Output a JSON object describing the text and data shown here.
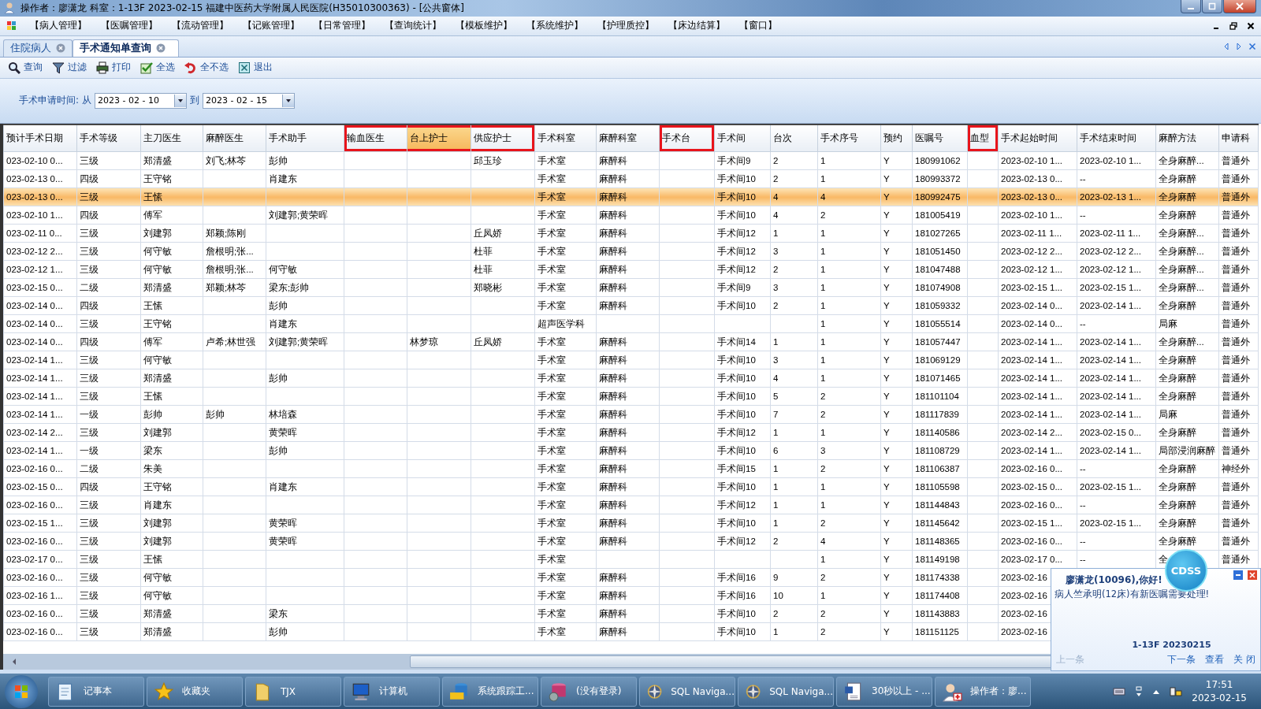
{
  "window": {
    "title": "操作者：廖潇龙  科室：1-13F  2023-02-15  福建中医药大学附属人民医院(H35010300363) - [公共窗体]"
  },
  "menu": [
    "【病人管理】",
    "【医嘱管理】",
    "【流动管理】",
    "【记账管理】",
    "【日常管理】",
    "【查询统计】",
    "【模板维护】",
    "【系统维护】",
    "【护理质控】",
    "【床边结算】",
    "【窗口】"
  ],
  "tabs": [
    {
      "label": "住院病人",
      "selected": false
    },
    {
      "label": "手术通知单查询",
      "selected": true
    }
  ],
  "toolbar": [
    {
      "label": "查询",
      "kind": "search"
    },
    {
      "label": "过滤",
      "kind": "filter"
    },
    {
      "label": "打印",
      "kind": "print"
    },
    {
      "label": "全选",
      "kind": "check"
    },
    {
      "label": "全不选",
      "kind": "undo"
    },
    {
      "label": "退出",
      "kind": "exit"
    }
  ],
  "filter": {
    "label": "手术申请时间:",
    "from_label": "从",
    "from": "2023 - 02 - 10",
    "to_label": "到",
    "to": "2023 - 02 - 15"
  },
  "table": {
    "columns": [
      {
        "label": "预计手术日期",
        "selected": false,
        "marked": false
      },
      {
        "label": "手术等级",
        "selected": false,
        "marked": false
      },
      {
        "label": "主刀医生",
        "selected": false,
        "marked": false
      },
      {
        "label": "麻醉医生",
        "selected": false,
        "marked": false
      },
      {
        "label": "手术助手",
        "selected": false,
        "marked": false
      },
      {
        "label": "输血医生",
        "selected": false,
        "marked": true
      },
      {
        "label": "台上护士",
        "selected": true,
        "marked": true
      },
      {
        "label": "供应护士",
        "selected": false,
        "marked": true
      },
      {
        "label": "手术科室",
        "selected": false,
        "marked": false
      },
      {
        "label": "麻醉科室",
        "selected": false,
        "marked": false
      },
      {
        "label": "手术台",
        "selected": false,
        "marked": true
      },
      {
        "label": "手术间",
        "selected": false,
        "marked": false
      },
      {
        "label": "台次",
        "selected": false,
        "marked": false
      },
      {
        "label": "手术序号",
        "selected": false,
        "marked": false
      },
      {
        "label": "预约",
        "selected": false,
        "marked": false
      },
      {
        "label": "医嘱号",
        "selected": false,
        "marked": false
      },
      {
        "label": "血型",
        "selected": false,
        "marked": true
      },
      {
        "label": "手术起始时间",
        "selected": false,
        "marked": false
      },
      {
        "label": "手术结束时间",
        "selected": false,
        "marked": false
      },
      {
        "label": "麻醉方法",
        "selected": false,
        "marked": false
      },
      {
        "label": "申请科",
        "selected": false,
        "marked": false
      }
    ],
    "rows": [
      {
        "selected": false,
        "cells": [
          "023-02-10 0...",
          "三级",
          "郑清盛",
          "刘飞;林芩",
          "彭帅",
          null,
          null,
          "邱玉珍",
          "手术室",
          "麻醉科",
          null,
          "手术间9",
          "2",
          "1",
          "Y",
          "180991062",
          null,
          "2023-02-10 1...",
          "2023-02-10 1...",
          "全身麻醉...",
          "普通外"
        ]
      },
      {
        "selected": false,
        "cells": [
          "023-02-13 0...",
          "四级",
          "王守铭",
          null,
          "肖建东",
          null,
          null,
          null,
          "手术室",
          "麻醉科",
          null,
          "手术间10",
          "2",
          "1",
          "Y",
          "180993372",
          null,
          "2023-02-13 0...",
          "--",
          "全身麻醉",
          "普通外"
        ]
      },
      {
        "selected": true,
        "cells": [
          "023-02-13 0...",
          "三级",
          "王愫",
          null,
          null,
          null,
          null,
          null,
          "手术室",
          "麻醉科",
          null,
          "手术间10",
          "4",
          "4",
          "Y",
          "180992475",
          null,
          "2023-02-13 0...",
          "2023-02-13 1...",
          "全身麻醉",
          "普通外"
        ]
      },
      {
        "selected": false,
        "cells": [
          "023-02-10 1...",
          "四级",
          "傅军",
          null,
          "刘建郭;黄荣晖",
          null,
          null,
          null,
          "手术室",
          "麻醉科",
          null,
          "手术间10",
          "4",
          "2",
          "Y",
          "181005419",
          null,
          "2023-02-10 1...",
          "--",
          "全身麻醉",
          "普通外"
        ]
      },
      {
        "selected": false,
        "cells": [
          "023-02-11 0...",
          "三级",
          "刘建郭",
          "郑颖;陈刚",
          null,
          null,
          null,
          "丘凤娇",
          "手术室",
          "麻醉科",
          null,
          "手术间12",
          "1",
          "1",
          "Y",
          "181027265",
          null,
          "2023-02-11 1...",
          "2023-02-11 1...",
          "全身麻醉...",
          "普通外"
        ]
      },
      {
        "selected": false,
        "cells": [
          "023-02-12 2...",
          "三级",
          "何守敏",
          "詹根明;张...",
          null,
          null,
          null,
          "杜菲",
          "手术室",
          "麻醉科",
          null,
          "手术间12",
          "3",
          "1",
          "Y",
          "181051450",
          null,
          "2023-02-12 2...",
          "2023-02-12 2...",
          "全身麻醉...",
          "普通外"
        ]
      },
      {
        "selected": false,
        "cells": [
          "023-02-12 1...",
          "三级",
          "何守敏",
          "詹根明;张...",
          "何守敏",
          null,
          null,
          "杜菲",
          "手术室",
          "麻醉科",
          null,
          "手术间12",
          "2",
          "1",
          "Y",
          "181047488",
          null,
          "2023-02-12 1...",
          "2023-02-12 1...",
          "全身麻醉...",
          "普通外"
        ]
      },
      {
        "selected": false,
        "cells": [
          "023-02-15 0...",
          "二级",
          "郑清盛",
          "郑颖;林芩",
          "梁东;彭帅",
          null,
          null,
          "郑晓彬",
          "手术室",
          "麻醉科",
          null,
          "手术间9",
          "3",
          "1",
          "Y",
          "181074908",
          null,
          "2023-02-15 1...",
          "2023-02-15 1...",
          "全身麻醉...",
          "普通外"
        ]
      },
      {
        "selected": false,
        "cells": [
          "023-02-14 0...",
          "四级",
          "王愫",
          null,
          "彭帅",
          null,
          null,
          null,
          "手术室",
          "麻醉科",
          null,
          "手术间10",
          "2",
          "1",
          "Y",
          "181059332",
          null,
          "2023-02-14 0...",
          "2023-02-14 1...",
          "全身麻醉",
          "普通外"
        ]
      },
      {
        "selected": false,
        "cells": [
          "023-02-14 0...",
          "三级",
          "王守铭",
          null,
          "肖建东",
          null,
          null,
          null,
          "超声医学科",
          null,
          null,
          null,
          null,
          "1",
          "Y",
          "181055514",
          null,
          "2023-02-14 0...",
          "--",
          "局麻",
          "普通外"
        ]
      },
      {
        "selected": false,
        "cells": [
          "023-02-14 0...",
          "四级",
          "傅军",
          "卢希;林世强",
          "刘建郭;黄荣晖",
          null,
          "林梦琼",
          "丘凤娇",
          "手术室",
          "麻醉科",
          null,
          "手术间14",
          "1",
          "1",
          "Y",
          "181057447",
          null,
          "2023-02-14 1...",
          "2023-02-14 1...",
          "全身麻醉...",
          "普通外"
        ]
      },
      {
        "selected": false,
        "cells": [
          "023-02-14 1...",
          "三级",
          "何守敏",
          null,
          null,
          null,
          null,
          null,
          "手术室",
          "麻醉科",
          null,
          "手术间10",
          "3",
          "1",
          "Y",
          "181069129",
          null,
          "2023-02-14 1...",
          "2023-02-14 1...",
          "全身麻醉",
          "普通外"
        ]
      },
      {
        "selected": false,
        "cells": [
          "023-02-14 1...",
          "三级",
          "郑清盛",
          null,
          "彭帅",
          null,
          null,
          null,
          "手术室",
          "麻醉科",
          null,
          "手术间10",
          "4",
          "1",
          "Y",
          "181071465",
          null,
          "2023-02-14 1...",
          "2023-02-14 1...",
          "全身麻醉",
          "普通外"
        ]
      },
      {
        "selected": false,
        "cells": [
          "023-02-14 1...",
          "三级",
          "王愫",
          null,
          null,
          null,
          null,
          null,
          "手术室",
          "麻醉科",
          null,
          "手术间10",
          "5",
          "2",
          "Y",
          "181101104",
          null,
          "2023-02-14 1...",
          "2023-02-14 1...",
          "全身麻醉",
          "普通外"
        ]
      },
      {
        "selected": false,
        "cells": [
          "023-02-14 1...",
          "一级",
          "彭帅",
          "彭帅",
          "林培森",
          null,
          null,
          null,
          "手术室",
          "麻醉科",
          null,
          "手术间10",
          "7",
          "2",
          "Y",
          "181117839",
          null,
          "2023-02-14 1...",
          "2023-02-14 1...",
          "局麻",
          "普通外"
        ]
      },
      {
        "selected": false,
        "cells": [
          "023-02-14 2...",
          "三级",
          "刘建郭",
          null,
          "黄荣晖",
          null,
          null,
          null,
          "手术室",
          "麻醉科",
          null,
          "手术间12",
          "1",
          "1",
          "Y",
          "181140586",
          null,
          "2023-02-14 2...",
          "2023-02-15 0...",
          "全身麻醉",
          "普通外"
        ]
      },
      {
        "selected": false,
        "cells": [
          "023-02-14 1...",
          "一级",
          "梁东",
          null,
          "彭帅",
          null,
          null,
          null,
          "手术室",
          "麻醉科",
          null,
          "手术间10",
          "6",
          "3",
          "Y",
          "181108729",
          null,
          "2023-02-14 1...",
          "2023-02-14 1...",
          "局部浸润麻醉",
          "普通外"
        ]
      },
      {
        "selected": false,
        "cells": [
          "023-02-16 0...",
          "二级",
          "朱美",
          null,
          null,
          null,
          null,
          null,
          "手术室",
          "麻醉科",
          null,
          "手术间15",
          "1",
          "2",
          "Y",
          "181106387",
          null,
          "2023-02-16 0...",
          "--",
          "全身麻醉",
          "神经外"
        ]
      },
      {
        "selected": false,
        "cells": [
          "023-02-15 0...",
          "四级",
          "王守铭",
          null,
          "肖建东",
          null,
          null,
          null,
          "手术室",
          "麻醉科",
          null,
          "手术间10",
          "1",
          "1",
          "Y",
          "181105598",
          null,
          "2023-02-15 0...",
          "2023-02-15 1...",
          "全身麻醉",
          "普通外"
        ]
      },
      {
        "selected": false,
        "cells": [
          "023-02-16 0...",
          "三级",
          "肖建东",
          null,
          null,
          null,
          null,
          null,
          "手术室",
          "麻醉科",
          null,
          "手术间12",
          "1",
          "1",
          "Y",
          "181144843",
          null,
          "2023-02-16 0...",
          "--",
          "全身麻醉",
          "普通外"
        ]
      },
      {
        "selected": false,
        "cells": [
          "023-02-15 1...",
          "三级",
          "刘建郭",
          null,
          "黄荣晖",
          null,
          null,
          null,
          "手术室",
          "麻醉科",
          null,
          "手术间10",
          "1",
          "2",
          "Y",
          "181145642",
          null,
          "2023-02-15 1...",
          "2023-02-15 1...",
          "全身麻醉",
          "普通外"
        ]
      },
      {
        "selected": false,
        "cells": [
          "023-02-16 0...",
          "三级",
          "刘建郭",
          null,
          "黄荣晖",
          null,
          null,
          null,
          "手术室",
          "麻醉科",
          null,
          "手术间12",
          "2",
          "4",
          "Y",
          "181148365",
          null,
          "2023-02-16 0...",
          "--",
          "全身麻醉",
          "普通外"
        ]
      },
      {
        "selected": false,
        "cells": [
          "023-02-17 0...",
          "三级",
          "王愫",
          null,
          null,
          null,
          null,
          null,
          "手术室",
          null,
          null,
          null,
          null,
          "1",
          "Y",
          "181149198",
          null,
          "2023-02-17 0...",
          "--",
          "全",
          "普通外"
        ]
      },
      {
        "selected": false,
        "cells": [
          "023-02-16 0...",
          "三级",
          "何守敏",
          null,
          null,
          null,
          null,
          null,
          "手术室",
          "麻醉科",
          null,
          "手术间16",
          "9",
          "2",
          "Y",
          "181174338",
          null,
          "2023-02-16",
          null,
          null,
          null
        ]
      },
      {
        "selected": false,
        "cells": [
          "023-02-16 1...",
          "三级",
          "何守敏",
          null,
          null,
          null,
          null,
          null,
          "手术室",
          "麻醉科",
          null,
          "手术间16",
          "10",
          "1",
          "Y",
          "181174408",
          null,
          "2023-02-16",
          null,
          null,
          null
        ]
      },
      {
        "selected": false,
        "cells": [
          "023-02-16 0...",
          "三级",
          "郑清盛",
          null,
          "梁东",
          null,
          null,
          null,
          "手术室",
          "麻醉科",
          null,
          "手术间10",
          "2",
          "2",
          "Y",
          "181143883",
          null,
          "2023-02-16",
          null,
          null,
          null
        ]
      },
      {
        "selected": false,
        "cells": [
          "023-02-16 0...",
          "三级",
          "郑清盛",
          null,
          "彭帅",
          null,
          null,
          null,
          "手术室",
          "麻醉科",
          null,
          "手术间10",
          "1",
          "2",
          "Y",
          "181151125",
          null,
          "2023-02-16",
          null,
          null,
          null
        ]
      }
    ]
  },
  "notification": {
    "badge": "CDSS",
    "greeting": "廖潇龙(10096),你好!",
    "message": "病人竺承明(12床)有新医嘱需要处理!",
    "footer": "1-13F 20230215",
    "actions": [
      {
        "label": "上一条",
        "disabled": true
      },
      {
        "label": "下一条",
        "disabled": false
      },
      {
        "label": "查看",
        "disabled": false
      },
      {
        "label": "关 闭",
        "disabled": false
      }
    ]
  },
  "taskbar": {
    "items": [
      {
        "label": "记事本",
        "kind": "notepad"
      },
      {
        "label": "收藏夹",
        "kind": "star"
      },
      {
        "label": "TJX",
        "kind": "folder"
      },
      {
        "label": "计算机",
        "kind": "computer"
      },
      {
        "label": "系统跟踪工...",
        "kind": "sql"
      },
      {
        "label": "(没有登录)",
        "kind": "database"
      },
      {
        "label": "SQL Naviga...",
        "kind": "compass"
      },
      {
        "label": "SQL Naviga...",
        "kind": "compass"
      },
      {
        "label": "30秒以上 - ...",
        "kind": "document"
      },
      {
        "label": "操作者：廖...",
        "kind": "nurse"
      }
    ],
    "time": "17:51",
    "date": "2023-02-15"
  }
}
